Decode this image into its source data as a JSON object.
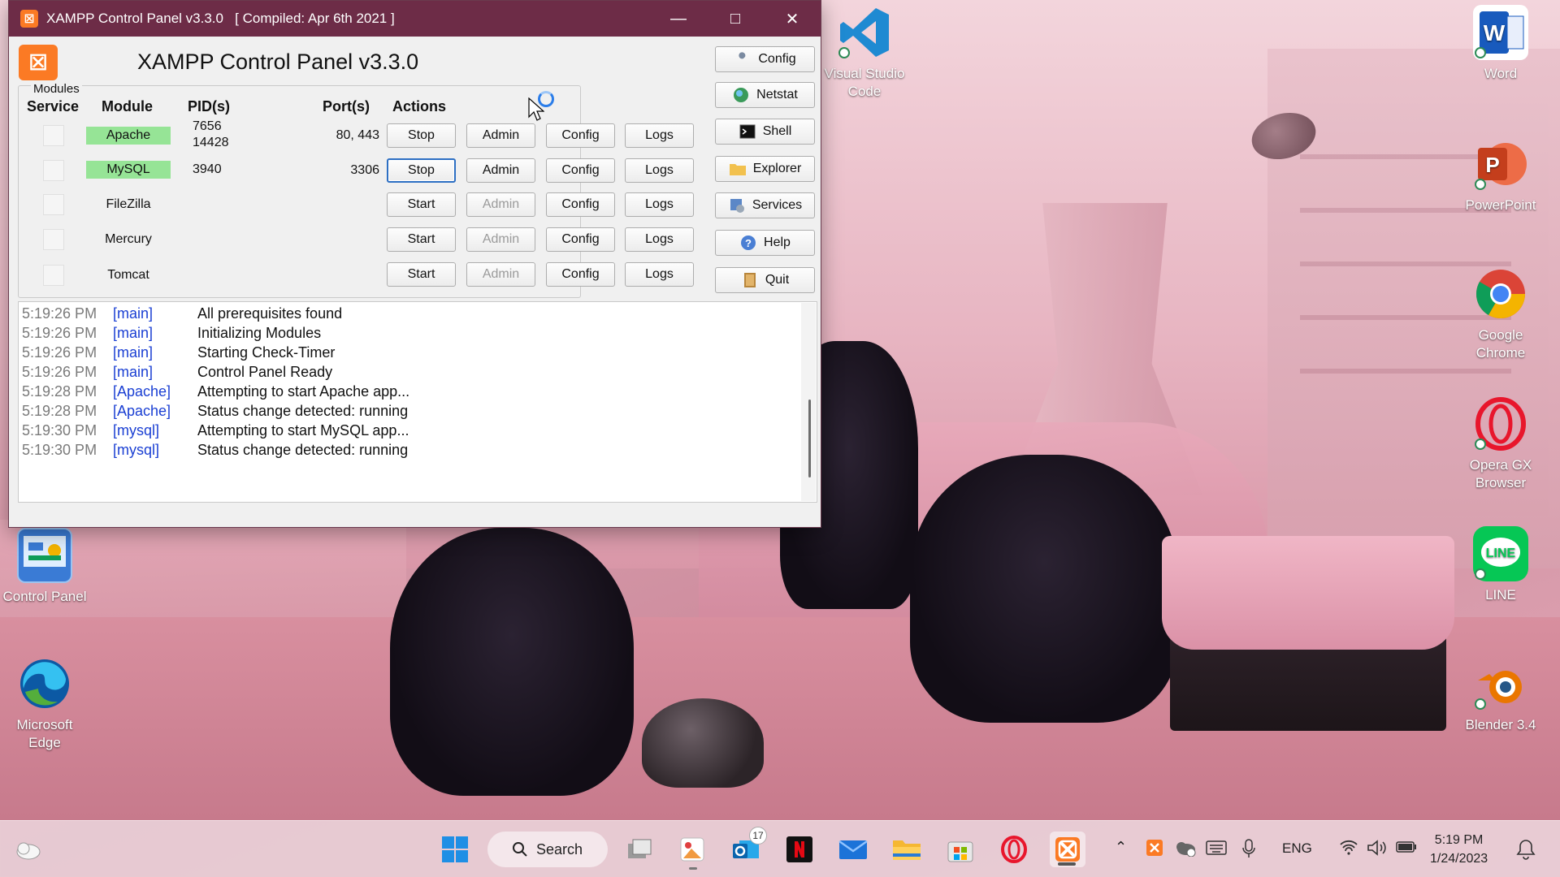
{
  "window": {
    "title": "XAMPP Control Panel v3.3.0   [ Compiled: Apr 6th 2021 ]",
    "heading": "XAMPP Control Panel v3.3.0",
    "modules_label": "Modules",
    "columns": {
      "service": "Service",
      "module": "Module",
      "pids": "PID(s)",
      "ports": "Port(s)",
      "actions": "Actions"
    },
    "rows": [
      {
        "module": "Apache",
        "pids": [
          "7656",
          "14428"
        ],
        "ports": "80, 443",
        "primary": "Stop",
        "admin": "Admin",
        "config": "Config",
        "logs": "Logs",
        "running": true
      },
      {
        "module": "MySQL",
        "pids": [
          "3940"
        ],
        "ports": "3306",
        "primary": "Stop",
        "admin": "Admin",
        "config": "Config",
        "logs": "Logs",
        "running": true
      },
      {
        "module": "FileZilla",
        "pids": [],
        "ports": "",
        "primary": "Start",
        "admin": "Admin",
        "config": "Config",
        "logs": "Logs",
        "running": false
      },
      {
        "module": "Mercury",
        "pids": [],
        "ports": "",
        "primary": "Start",
        "admin": "Admin",
        "config": "Config",
        "logs": "Logs",
        "running": false
      },
      {
        "module": "Tomcat",
        "pids": [],
        "ports": "",
        "primary": "Start",
        "admin": "Admin",
        "config": "Config",
        "logs": "Logs",
        "running": false
      }
    ],
    "side_buttons": [
      {
        "label": "Config",
        "icon": "wrench-icon"
      },
      {
        "label": "Netstat",
        "icon": "globe-icon"
      },
      {
        "label": "Shell",
        "icon": "terminal-icon"
      },
      {
        "label": "Explorer",
        "icon": "folder-icon"
      },
      {
        "label": "Services",
        "icon": "services-icon"
      },
      {
        "label": "Help",
        "icon": "help-icon"
      },
      {
        "label": "Quit",
        "icon": "quit-icon"
      }
    ],
    "log": [
      {
        "time": "5:19:26 PM",
        "source": "[main]",
        "message": "All prerequisites found"
      },
      {
        "time": "5:19:26 PM",
        "source": "[main]",
        "message": "Initializing Modules"
      },
      {
        "time": "5:19:26 PM",
        "source": "[main]",
        "message": "Starting Check-Timer"
      },
      {
        "time": "5:19:26 PM",
        "source": "[main]",
        "message": "Control Panel Ready"
      },
      {
        "time": "5:19:28 PM",
        "source": "[Apache]",
        "message": "Attempting to start Apache app..."
      },
      {
        "time": "5:19:28 PM",
        "source": "[Apache]",
        "message": "Status change detected: running"
      },
      {
        "time": "5:19:30 PM",
        "source": "[mysql]",
        "message": "Attempting to start MySQL app..."
      },
      {
        "time": "5:19:30 PM",
        "source": "[mysql]",
        "message": "Status change detected: running"
      }
    ]
  },
  "desktop_icons": {
    "vscode": "Visual Studio Code",
    "word": "Word",
    "powerpoint": "PowerPoint",
    "chrome": "Google Chrome",
    "opera": "Opera GX Browser",
    "line": "LINE",
    "blender": "Blender 3.4",
    "control_panel": "Control Panel",
    "edge": "Microsoft Edge"
  },
  "taskbar": {
    "search_label": "Search",
    "mail_badge": "17",
    "language": "ENG",
    "time": "5:19 PM",
    "date": "1/24/2023"
  },
  "colors": {
    "title_bar": "#6d2c47",
    "running_green": "#96e496",
    "log_source_blue": "#1a3fd3",
    "xampp_orange": "#fb7a24"
  }
}
